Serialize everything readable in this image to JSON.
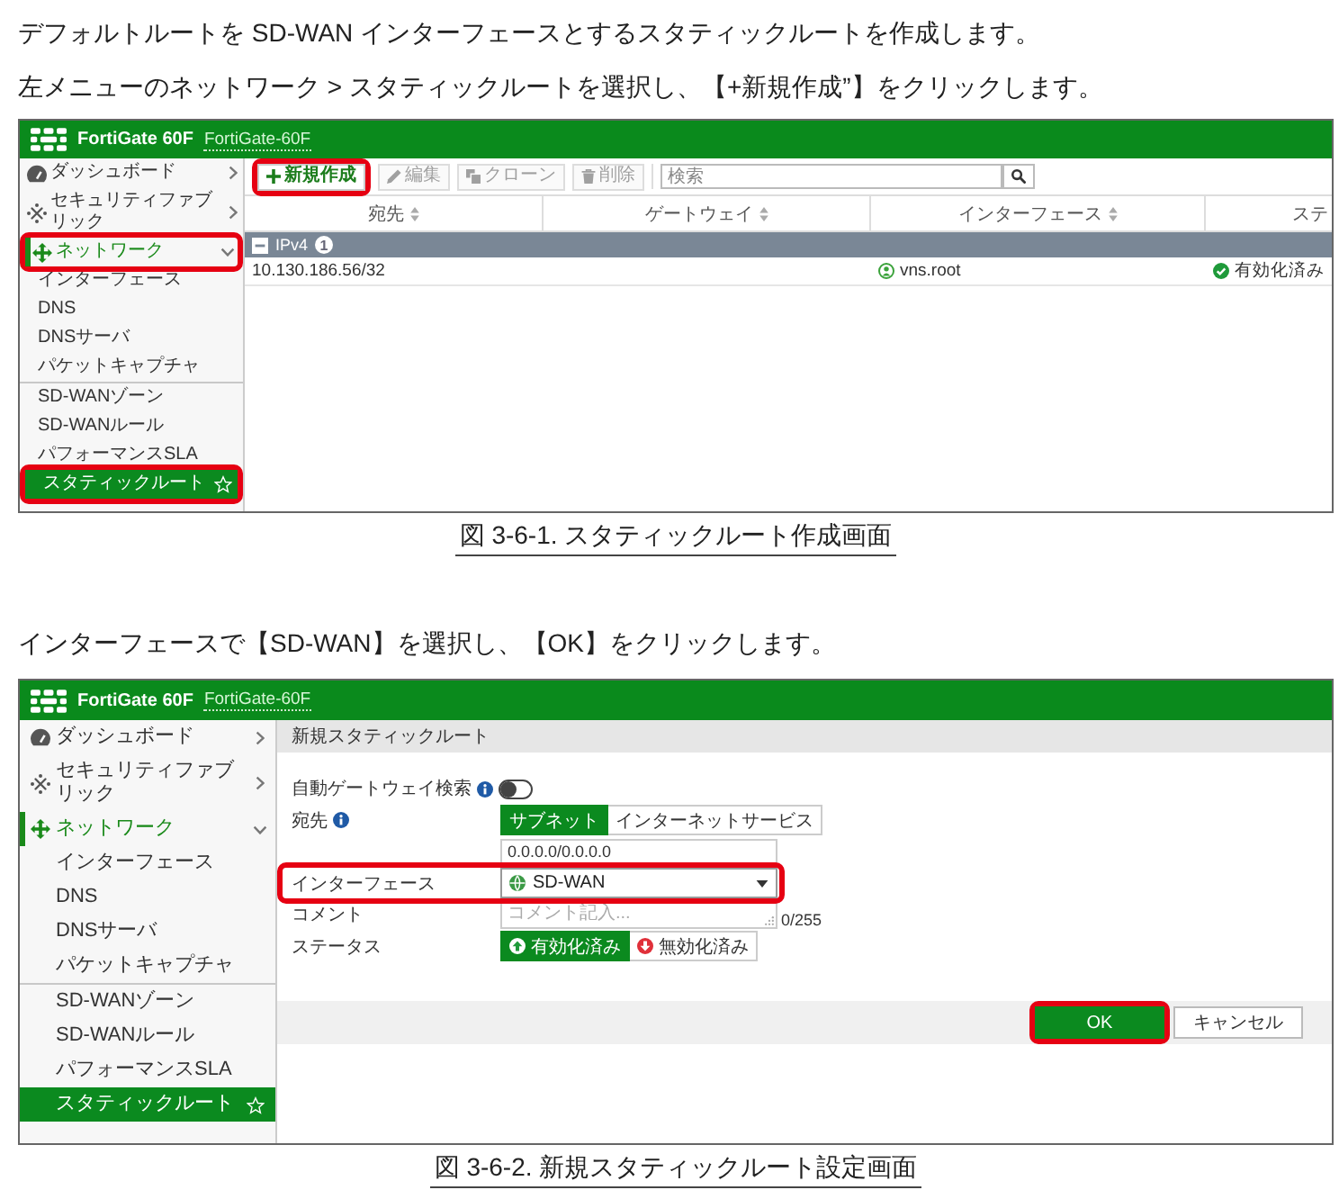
{
  "intro": [
    "デフォルトルートを SD-WAN インターフェースとするスタティックルートを作成します。",
    "左メニューのネットワーク > スタティックルートを選択し、【+新規作成”】をクリックします。"
  ],
  "figure_1": {
    "screenshot": {
      "header": {
        "product": "FortiGate 60F",
        "hostname": "FortiGate-60F"
      },
      "sidebar": {
        "items": [
          {
            "label": "ダッシュボード",
            "kind": "dashboard",
            "selected": false,
            "expanded": false,
            "highlighted": false
          },
          {
            "label": "セキュリティファブリック",
            "kind": "fabric",
            "selected": false,
            "expanded": false,
            "highlighted": false
          },
          {
            "label": "ネットワーク",
            "kind": "network",
            "selected": true,
            "expanded": true,
            "highlighted": true,
            "children": [
              {
                "label": "インターフェース",
                "selected": false,
                "highlighted": false,
                "divider_before": false
              },
              {
                "label": "DNS",
                "selected": false,
                "highlighted": false,
                "divider_before": false
              },
              {
                "label": "DNSサーバ",
                "selected": false,
                "highlighted": false,
                "divider_before": false
              },
              {
                "label": "パケットキャプチャ",
                "selected": false,
                "highlighted": false,
                "divider_before": false
              },
              {
                "label": "SD-WANゾーン",
                "selected": false,
                "highlighted": false,
                "divider_before": true
              },
              {
                "label": "SD-WANルール",
                "selected": false,
                "highlighted": false,
                "divider_before": false
              },
              {
                "label": "パフォーマンスSLA",
                "selected": false,
                "highlighted": false,
                "divider_before": false
              },
              {
                "label": "スタティックルート",
                "selected": true,
                "highlighted": true,
                "divider_before": false
              }
            ]
          }
        ]
      },
      "main": {
        "kind": "list",
        "toolbar": {
          "buttons": [
            {
              "label": "新規作成",
              "kind": "create",
              "disabled": false,
              "highlighted": true
            },
            {
              "label": "編集",
              "kind": "edit",
              "disabled": true,
              "highlighted": false
            },
            {
              "label": "クローン",
              "kind": "clone",
              "disabled": true,
              "highlighted": false
            },
            {
              "label": "削除",
              "kind": "delete",
              "disabled": true,
              "highlighted": false
            }
          ],
          "search": {
            "placeholder": "検索"
          }
        },
        "table": {
          "columns": [
            {
              "label": "宛先",
              "sortable": true
            },
            {
              "label": "ゲートウェイ",
              "sortable": true
            },
            {
              "label": "インターフェース",
              "sortable": true
            },
            {
              "label": "ステ",
              "sortable": false
            }
          ],
          "groups": [
            {
              "label": "IPv4",
              "count": "1",
              "expanded": true,
              "rows": [
                {
                  "destination": "10.130.186.56/32",
                  "interface": "vns.root",
                  "status": "有効化済み",
                  "enabled": true
                }
              ]
            }
          ]
        }
      }
    },
    "caption": "図 3-6-1. スタティックルート作成画面"
  },
  "instruction": "インターフェースで【SD-WAN】を選択し、【OK】をクリックします。",
  "figure_2": {
    "screenshot": {
      "header": {
        "product": "FortiGate 60F",
        "hostname": "FortiGate-60F"
      },
      "sidebar": {
        "items": [
          {
            "label": "ダッシュボード",
            "kind": "dashboard",
            "selected": false,
            "expanded": false,
            "highlighted": false
          },
          {
            "label": "セキュリティファブリック",
            "kind": "fabric",
            "selected": false,
            "expanded": false,
            "highlighted": false
          },
          {
            "label": "ネットワーク",
            "kind": "network",
            "selected": true,
            "expanded": true,
            "highlighted": false,
            "children": [
              {
                "label": "インターフェース",
                "selected": false,
                "highlighted": false,
                "divider_before": false
              },
              {
                "label": "DNS",
                "selected": false,
                "highlighted": false,
                "divider_before": false
              },
              {
                "label": "DNSサーバ",
                "selected": false,
                "highlighted": false,
                "divider_before": false
              },
              {
                "label": "パケットキャプチャ",
                "selected": false,
                "highlighted": false,
                "divider_before": false
              },
              {
                "label": "SD-WANゾーン",
                "selected": false,
                "highlighted": false,
                "divider_before": true
              },
              {
                "label": "SD-WANルール",
                "selected": false,
                "highlighted": false,
                "divider_before": false
              },
              {
                "label": "パフォーマンスSLA",
                "selected": false,
                "highlighted": false,
                "divider_before": false
              },
              {
                "label": "スタティックルート",
                "selected": true,
                "highlighted": false,
                "divider_before": false
              }
            ]
          }
        ]
      },
      "main": {
        "kind": "form",
        "title": "新規スタティックルート",
        "fields": [
          {
            "kind": "toggle",
            "label": "自動ゲートウェイ検索",
            "info": true,
            "on": false,
            "highlighted": false
          },
          {
            "kind": "choice",
            "label": "宛先",
            "info": true,
            "highlighted": false,
            "options": [
              {
                "label": "サブネット",
                "kind": "plain",
                "selected": true
              },
              {
                "label": "インターネットサービス",
                "kind": "plain",
                "selected": false
              }
            ]
          },
          {
            "kind": "input",
            "info": false,
            "highlighted": false,
            "value": "0.0.0.0/0.0.0.0"
          },
          {
            "kind": "select",
            "label": "インターフェース",
            "info": false,
            "highlighted": true,
            "value": "SD-WAN"
          },
          {
            "kind": "textarea",
            "label": "コメント",
            "info": false,
            "highlighted": false,
            "placeholder": "コメント記入...",
            "counter": "0/255"
          },
          {
            "kind": "choice",
            "label": "ステータス",
            "info": false,
            "highlighted": false,
            "options": [
              {
                "label": "有効化済み",
                "kind": "enable",
                "selected": true
              },
              {
                "label": "無効化済み",
                "kind": "disable",
                "selected": false
              }
            ]
          }
        ],
        "buttons": [
          {
            "label": "OK",
            "kind": "primary",
            "highlighted": true
          },
          {
            "label": "キャンセル",
            "kind": "secondary",
            "highlighted": false
          }
        ]
      }
    },
    "caption": "図 3-6-2. 新規スタティックルート設定画面"
  }
}
